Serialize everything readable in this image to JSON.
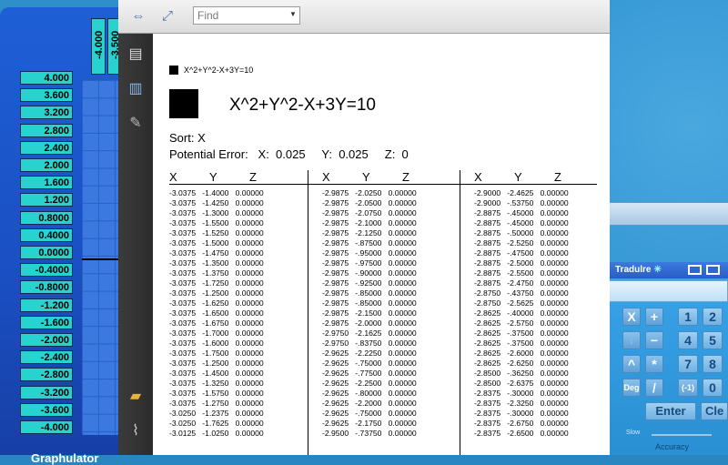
{
  "graphulator": {
    "title": "Graphulator",
    "x_labels": [
      "-4.000",
      "-3.500"
    ],
    "y_labels": [
      "4.000",
      "3.600",
      "3.200",
      "2.800",
      "2.400",
      "2.000",
      "1.600",
      "1.200",
      "0.8000",
      "0.4000",
      "0.0000",
      "-0.4000",
      "-0.8000",
      "-1.200",
      "-1.600",
      "-2.000",
      "-2.400",
      "-2.800",
      "-3.200",
      "-3.600",
      "-4.000"
    ]
  },
  "viewer": {
    "find_placeholder": "Find",
    "legend_text": "X^2+Y^2-X+3Y=10",
    "title": "X^2+Y^2-X+3Y=10",
    "sort_line": "Sort:  X",
    "error_line": "Potential Error:   X:  0.025     Y:  0.025     Z:  0",
    "column_headers": [
      "X",
      "Y",
      "Z"
    ],
    "columns": [
      [
        "-3.0375   -1.4000   0.00000",
        "-3.0375   -1.4250   0.00000",
        "-3.0375   -1.3000   0.00000",
        "-3.0375   -1.5500   0.00000",
        "-3.0375   -1.5250   0.00000",
        "-3.0375   -1.5000   0.00000",
        "-3.0375   -1.4750   0.00000",
        "-3.0375   -1.3500   0.00000",
        "-3.0375   -1.3750   0.00000",
        "-3.0375   -1.7250   0.00000",
        "-3.0375   -1.2500   0.00000",
        "-3.0375   -1.6250   0.00000",
        "-3.0375   -1.6500   0.00000",
        "-3.0375   -1.6750   0.00000",
        "-3.0375   -1.7000   0.00000",
        "-3.0375   -1.6000   0.00000",
        "-3.0375   -1.7500   0.00000",
        "-3.0375   -1.2500   0.00000",
        "-3.0375   -1.4500   0.00000",
        "-3.0375   -1.3250   0.00000",
        "-3.0375   -1.5750   0.00000",
        "-3.0375   -1.2750   0.00000",
        "-3.0250   -1.2375   0.00000",
        "-3.0250   -1.7625   0.00000",
        "-3.0125   -1.0250   0.00000"
      ],
      [
        "-2.9875   -2.0250   0.00000",
        "-2.9875   -2.0500   0.00000",
        "-2.9875   -2.0750   0.00000",
        "-2.9875   -2.1000   0.00000",
        "-2.9875   -2.1250   0.00000",
        "-2.9875   -.87500   0.00000",
        "-2.9875   -.95000   0.00000",
        "-2.9875   -.97500   0.00000",
        "-2.9875   -.90000   0.00000",
        "-2.9875   -.92500   0.00000",
        "-2.9875   -.85000   0.00000",
        "-2.9875   -.85000   0.00000",
        "-2.9875   -2.1500   0.00000",
        "-2.9875   -2.0000   0.00000",
        "-2.9750   -2.1625   0.00000",
        "-2.9750   -.83750   0.00000",
        "-2.9625   -2.2250   0.00000",
        "-2.9625   -.75000   0.00000",
        "-2.9625   -.77500   0.00000",
        "-2.9625   -2.2500   0.00000",
        "-2.9625   -.80000   0.00000",
        "-2.9625   -2.2000   0.00000",
        "-2.9625   -.75000   0.00000",
        "-2.9625   -2.1750   0.00000",
        "-2.9500   -.73750   0.00000"
      ],
      [
        "-2.9000   -2.4625   0.00000",
        "-2.9000   -.53750   0.00000",
        "-2.8875   -.45000   0.00000",
        "-2.8875   -.45000   0.00000",
        "-2.8875   -.50000   0.00000",
        "-2.8875   -2.5250   0.00000",
        "-2.8875   -.47500   0.00000",
        "-2.8875   -2.5000   0.00000",
        "-2.8875   -2.5500   0.00000",
        "-2.8875   -2.4750   0.00000",
        "-2.8750   -.43750   0.00000",
        "-2.8750   -2.5625   0.00000",
        "-2.8625   -.40000   0.00000",
        "-2.8625   -2.5750   0.00000",
        "-2.8625   -.37500   0.00000",
        "-2.8625   -.37500   0.00000",
        "-2.8625   -2.6000   0.00000",
        "-2.8625   -2.6250   0.00000",
        "-2.8500   -.36250   0.00000",
        "-2.8500   -2.6375   0.00000",
        "-2.8375   -.30000   0.00000",
        "-2.8375   -2.3250   0.00000",
        "-2.8375   -.30000   0.00000",
        "-2.8375   -2.6750   0.00000",
        "-2.8375   -2.6500   0.00000"
      ]
    ]
  },
  "calculator": {
    "title": "Tradulre",
    "keys": {
      "x": "X",
      "plus": "+",
      "y": "Y",
      "minus": "−",
      "caret": "^",
      "times": "*",
      "deg": "Deg",
      "divide": "/",
      "neg": "(-1)",
      "zero": "0",
      "one": "1",
      "two": "2",
      "four": "4",
      "five": "5",
      "seven": "7",
      "eight": "8",
      "enter": "Enter",
      "clear": "Cle"
    },
    "slow_label": "Slow",
    "accuracy_label": "Accuracy"
  },
  "colors": {
    "grapher_blue": "#1e5fd6",
    "label_cyan": "#28d2cf",
    "calc_blue": "#2a8fd3"
  }
}
